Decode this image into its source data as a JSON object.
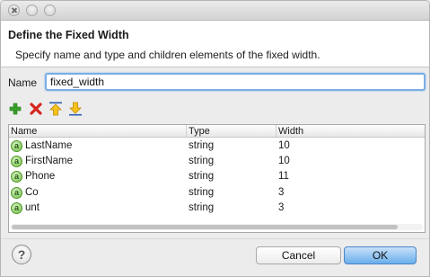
{
  "dialog": {
    "header_title": "Define the Fixed Width",
    "header_description": "Specify name and type and children elements of the fixed width."
  },
  "name_field": {
    "label": "Name",
    "value": "fixed_width"
  },
  "toolbar": {
    "icons": [
      "add-icon",
      "delete-icon",
      "move-up-icon",
      "move-down-icon"
    ],
    "colors": {
      "add": "#3aa12c",
      "delete": "#d7261e",
      "arrows": "#f0b000"
    }
  },
  "table": {
    "columns": [
      "Name",
      "Type",
      "Width"
    ],
    "rows": [
      {
        "name": "LastName",
        "type": "string",
        "width": "10"
      },
      {
        "name": "FirstName",
        "type": "string",
        "width": "10"
      },
      {
        "name": "Phone",
        "type": "string",
        "width": "11"
      },
      {
        "name": "Co",
        "type": "string",
        "width": "3"
      },
      {
        "name": "unt",
        "type": "string",
        "width": "3"
      }
    ],
    "row_icon": "attribute-icon",
    "row_icon_glyph": "a"
  },
  "buttons": {
    "help": "?",
    "cancel": "Cancel",
    "ok": "OK"
  },
  "colors": {
    "accent": "#6aaeeb",
    "focus_ring": "#7aaee3"
  }
}
